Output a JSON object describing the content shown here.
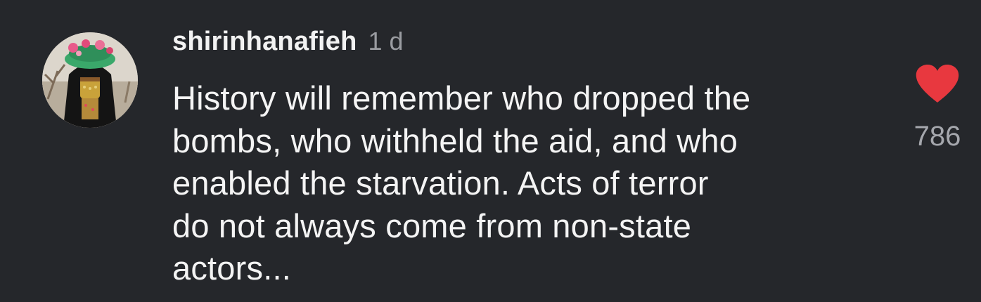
{
  "comment": {
    "username": "shirinhanafieh",
    "timestamp": "1 d",
    "text_lines": [
      "History will remember who dropped the",
      "bombs, who withheld the aid, and who",
      "enabled the starvation. Acts of terror",
      "do not always come from non-state",
      "actors..."
    ],
    "likes": "786",
    "liked": true
  },
  "colors": {
    "background": "#25272b",
    "username": "#f2f2f2",
    "timestamp": "#9a9ca1",
    "text": "#f4f4f4",
    "heart": "#e8383f",
    "like_count": "#a5a7ad"
  },
  "icons": {
    "like": "heart-filled-icon",
    "avatar": "profile-photo"
  }
}
